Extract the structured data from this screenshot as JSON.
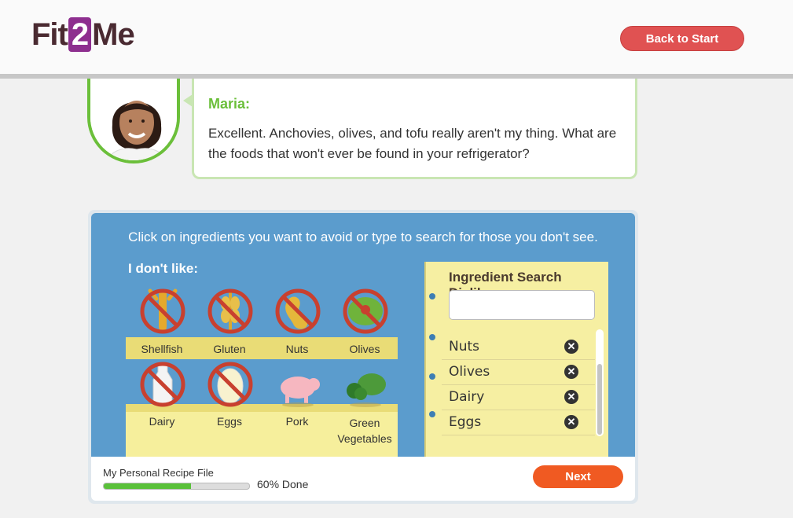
{
  "header": {
    "logo_part1": "Fit",
    "logo_part2": "2",
    "logo_part3": "Me",
    "back_button": "Back to Start"
  },
  "dialog": {
    "speaker": "Maria:",
    "message": "Excellent. Anchovies, olives, and tofu really aren't my thing. What are the foods that won't ever be found in your refrigerator?"
  },
  "panel": {
    "instruction": "Click on ingredients you want to avoid or type to search for those you don't see.",
    "dislike_heading": "I don't like:",
    "ingredients": [
      {
        "label": "Shellfish",
        "selected": true,
        "icon": "shellfish-icon"
      },
      {
        "label": "Gluten",
        "selected": true,
        "icon": "wheat-icon"
      },
      {
        "label": "Nuts",
        "selected": true,
        "icon": "peanut-icon"
      },
      {
        "label": "Olives",
        "selected": true,
        "icon": "olive-icon"
      },
      {
        "label": "Dairy",
        "selected": true,
        "icon": "milk-bottle-icon"
      },
      {
        "label": "Eggs",
        "selected": true,
        "icon": "egg-icon"
      },
      {
        "label": "Pork",
        "selected": false,
        "icon": "pig-icon"
      },
      {
        "label": "Green Vegetables",
        "selected": false,
        "icon": "vegetables-icon"
      }
    ],
    "search": {
      "title": "Ingredient Search Dislikes",
      "value": "",
      "placeholder": "",
      "list": [
        "Nuts",
        "Olives",
        "Dairy",
        "Eggs"
      ]
    }
  },
  "footer": {
    "label": "My Personal Recipe File",
    "progress_label": "60% Done",
    "progress": 0.6,
    "next_button": "Next"
  },
  "colors": {
    "brand_plum": "#4a2a31",
    "brand_purple": "#8e2f8f",
    "accent_green": "#6bbf3a",
    "panel_blue": "#5b9ccd",
    "back_red": "#e05252",
    "next_orange": "#f05a22"
  }
}
